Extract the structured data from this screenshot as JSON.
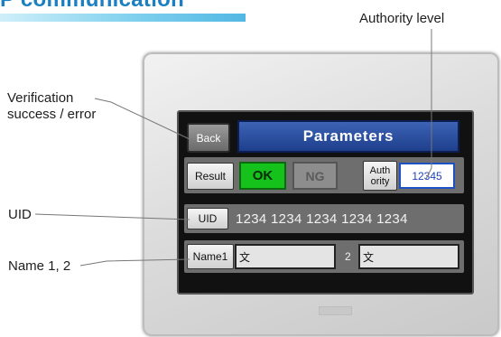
{
  "heading": {
    "text": "P communication"
  },
  "callouts": {
    "authority": "Authority level",
    "verification_line1": "Verification",
    "verification_line2": "success / error",
    "uid": "UID",
    "names": "Name 1, 2"
  },
  "screen": {
    "back_label": "Back",
    "title": "Parameters",
    "result_label": "Result",
    "ok_label": "OK",
    "ng_label": "NG",
    "authority_label_line1": "Auth",
    "authority_label_line2": "ority",
    "authority_value": "12345",
    "uid_label": "UID",
    "uid_value": "1234 1234 1234 1234 1234",
    "name1_label": "Name1",
    "name1_value": "文",
    "name2_label": "2",
    "name2_value": "文"
  },
  "colors": {
    "heading": "#1b7fc0",
    "ok": "#15c21b",
    "title_bar": "#2a4fa3",
    "authority_border": "#1d52c4"
  }
}
